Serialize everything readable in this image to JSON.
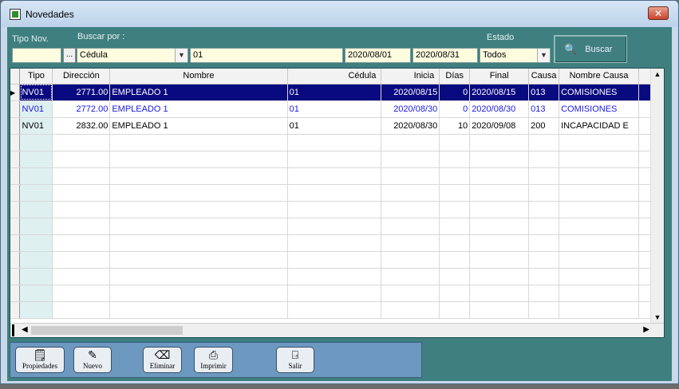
{
  "window": {
    "title": "Novedades",
    "close_label": "✕"
  },
  "filters": {
    "tipo_nov_label": "Tipo Nov.",
    "buscar_por_label": "Buscar por :",
    "estado_label": "Estado",
    "tipo_nov_value": "",
    "ellipsis_label": "...",
    "buscar_por_value": "Cédula",
    "search_value": "01",
    "fecha_desde": "2020/08/01",
    "fecha_hasta": "2020/08/31",
    "estado_value": "Todos",
    "buscar_button": "Buscar"
  },
  "grid": {
    "columns": [
      "Tipo",
      "Dirección",
      "Nombre",
      "Cédula",
      "Inicia",
      "Días",
      "Final",
      "Causa",
      "Nombre Causa"
    ],
    "rows": [
      {
        "tipo": "NV01",
        "direccion": "2771.00",
        "nombre": "EMPLEADO 1",
        "cedula": "01",
        "inicia": "2020/08/15",
        "dias": "0",
        "final": "2020/08/15",
        "causa": "013",
        "nombre_causa": "COMISIONES"
      },
      {
        "tipo": "NV01",
        "direccion": "2772.00",
        "nombre": "EMPLEADO 1",
        "cedula": "01",
        "inicia": "2020/08/30",
        "dias": "0",
        "final": "2020/08/30",
        "causa": "013",
        "nombre_causa": "COMISIONES"
      },
      {
        "tipo": "NV01",
        "direccion": "2832.00",
        "nombre": "EMPLEADO 1",
        "cedula": "01",
        "inicia": "2020/08/30",
        "dias": "10",
        "final": "2020/09/08",
        "causa": "200",
        "nombre_causa": "INCAPACIDAD E"
      }
    ]
  },
  "toolbar": {
    "propiedades": "Propiedades",
    "nuevo": "Nuevo",
    "eliminar": "Eliminar",
    "imprimir": "Imprimir",
    "salir": "Salir"
  },
  "colors": {
    "panel": "#3f7f7f",
    "selection": "#0a0a80",
    "link_blue": "#1a1adf",
    "toolbar": "#6d98c0"
  }
}
